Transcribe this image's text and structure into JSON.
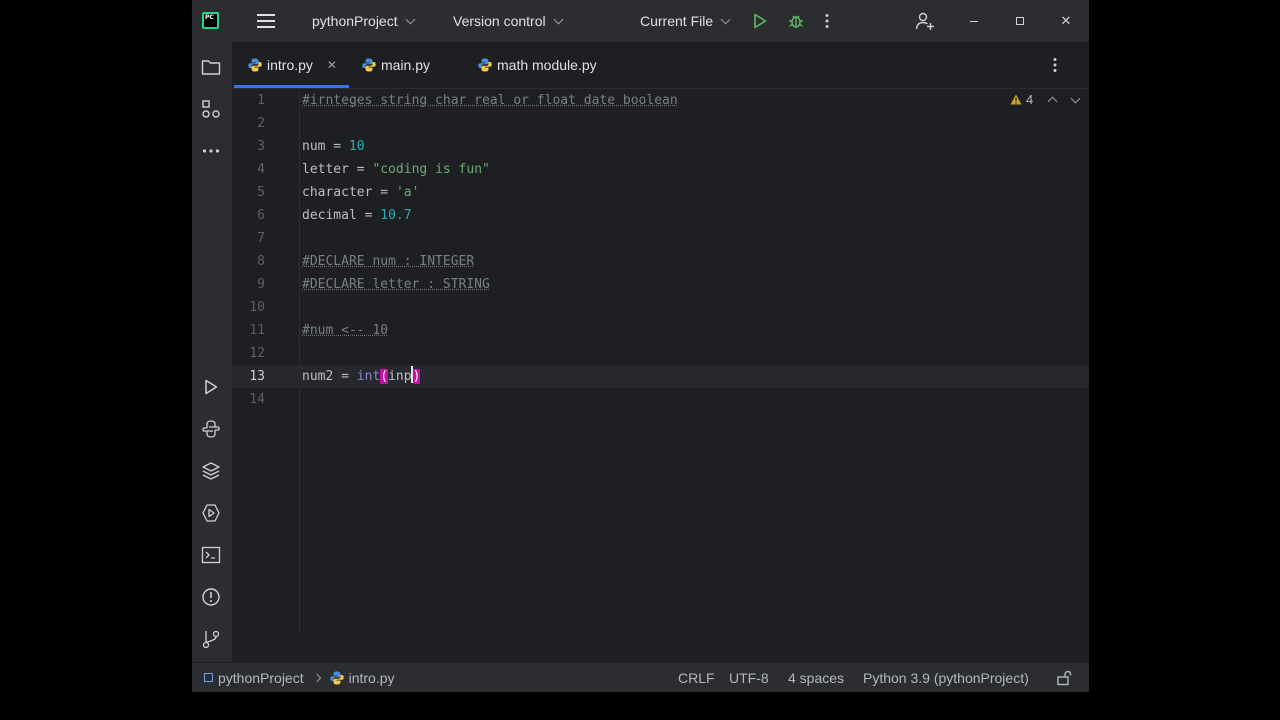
{
  "titlebar": {
    "app_logo_text": "PC",
    "project": "pythonProject",
    "vcs": "Version control",
    "run_config": "Current File"
  },
  "tabs": [
    {
      "label": "intro.py",
      "active": true
    },
    {
      "label": "main.py",
      "active": false
    },
    {
      "label": "math module.py",
      "active": false
    }
  ],
  "editor": {
    "current_line": 13,
    "warnings_count": "4",
    "line_numbers": [
      "1",
      "2",
      "3",
      "4",
      "5",
      "6",
      "7",
      "8",
      "9",
      "10",
      "11",
      "12",
      "13",
      "14"
    ],
    "lines": {
      "l1": "#irnteges string char real or float date boolean",
      "l3_var": "num",
      "l3_op": " = ",
      "l3_val": "10",
      "l4_var": "letter",
      "l4_op": " = ",
      "l4_val": "\"coding is fun\"",
      "l5_var": "character",
      "l5_op": " = ",
      "l5_val": "'a'",
      "l6_var": "decimal",
      "l6_op": " = ",
      "l6_val": "10.7",
      "l8": "#DECLARE num : INTEGER",
      "l9": "#DECLARE letter : STRING",
      "l11": "#num <-- 10",
      "l13_var": "num2",
      "l13_op": " = ",
      "l13_fn": "int",
      "l13_open": "(",
      "l13_arg": "inp",
      "l13_close": ")"
    }
  },
  "statusbar": {
    "project": "pythonProject",
    "file": "intro.py",
    "line_sep": "CRLF",
    "encoding": "UTF-8",
    "indent": "4 spaces",
    "interpreter": "Python 3.9 (pythonProject)"
  },
  "colors": {
    "accent": "#3574f0",
    "comment": "#7a7e85",
    "number": "#2aacb8",
    "string": "#6aab73",
    "builtin": "#8888c6",
    "bracket_highlight": "#c30fa6",
    "run_green": "#5fb865"
  }
}
